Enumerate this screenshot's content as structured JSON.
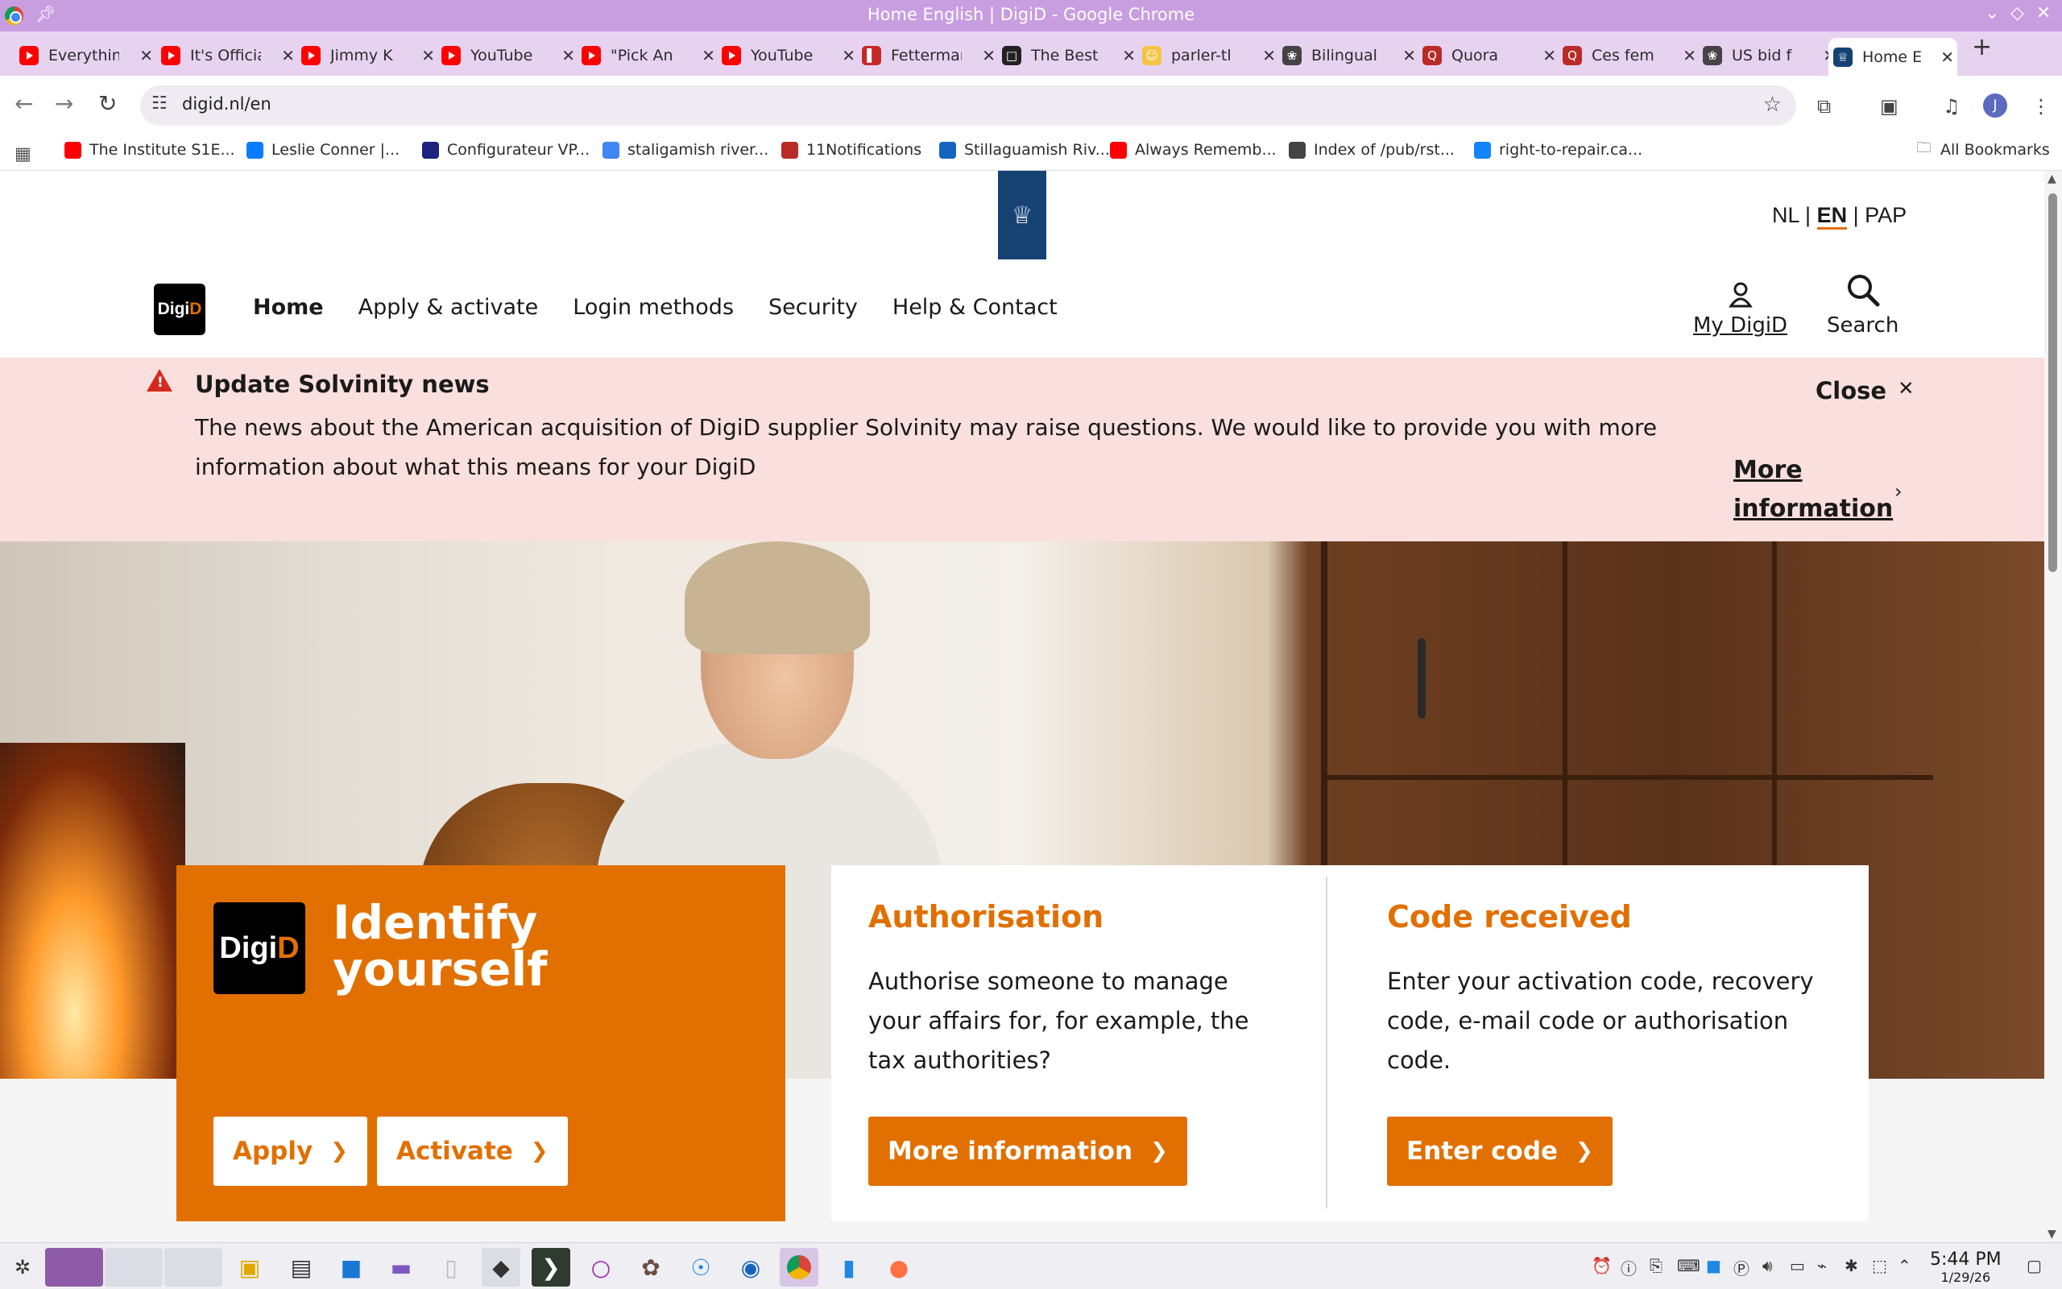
{
  "window": {
    "title": "Home English | DigiD - Google Chrome"
  },
  "tabs": [
    {
      "label": "Everything",
      "fav": "yt"
    },
    {
      "label": "It's Official",
      "fav": "yt"
    },
    {
      "label": "Jimmy K",
      "fav": "yt"
    },
    {
      "label": "YouTube",
      "fav": "yt"
    },
    {
      "label": "\"Pick An",
      "fav": "yt"
    },
    {
      "label": "YouTube",
      "fav": "yt"
    },
    {
      "label": "Fetterman",
      "fav": "fetterman"
    },
    {
      "label": "The Best",
      "fav": "doc"
    },
    {
      "label": "parler-tl",
      "fav": "emoji"
    },
    {
      "label": "Bilingual",
      "fav": "openai"
    },
    {
      "label": "Quora",
      "fav": "quora"
    },
    {
      "label": "Ces fem",
      "fav": "quora"
    },
    {
      "label": "US bid f",
      "fav": "openai"
    },
    {
      "label": "Home E",
      "fav": "digid",
      "active": true
    }
  ],
  "omnibox": {
    "url": "digid.nl/en"
  },
  "bookmarks": [
    {
      "label": "The Institute S1E...",
      "color": "#ff0000"
    },
    {
      "label": "Leslie Conner |...",
      "color": "#0a7cff"
    },
    {
      "label": "Configurateur VP...",
      "color": "#1a237e"
    },
    {
      "label": "staligamish river...",
      "color": "#4285f4"
    },
    {
      "label": "11Notifications",
      "color": "#b92b27"
    },
    {
      "label": "Stillaguamish Riv...",
      "color": "#1565c0"
    },
    {
      "label": "Always Rememb...",
      "color": "#ff0000"
    },
    {
      "label": "Index of /pub/rst...",
      "color": "#444444"
    },
    {
      "label": "right-to-repair.ca...",
      "color": "#1185fe"
    }
  ],
  "all_bookmarks": "All Bookmarks",
  "site": {
    "lang": {
      "nl": "NL",
      "en": "EN",
      "pap": "PAP",
      "sep": "|"
    },
    "logo": {
      "digi": "Digi",
      "d": "D"
    },
    "nav": [
      "Home",
      "Apply & activate",
      "Login methods",
      "Security",
      "Help & Contact"
    ],
    "my_digid": "My DigiD",
    "search": "Search",
    "alert": {
      "title": "Update Solvinity news",
      "body": "The news about the American acquisition of DigiD supplier Solvinity may raise questions. We would like to provide you with more information about what this means for your DigiD",
      "close": "Close",
      "more": "More information"
    },
    "identify": {
      "heading_line1": "Identify",
      "heading_line2": "yourself",
      "apply": "Apply",
      "activate": "Activate"
    },
    "authorisation": {
      "title": "Authorisation",
      "text": "Authorise someone to manage your affairs for, for example, the tax authorities?",
      "button": "More information"
    },
    "code": {
      "title": "Code received",
      "text": "Enter your activation code, recovery code, e-mail code or authorisation code.",
      "button": "Enter code"
    }
  },
  "clock": {
    "time": "5:44 PM",
    "date": "1/29/26"
  },
  "colors": {
    "accent": "#e17000",
    "alert_bg": "#f9dfdd",
    "gov_blue": "#154273",
    "titlebar": "#c89ee0"
  }
}
